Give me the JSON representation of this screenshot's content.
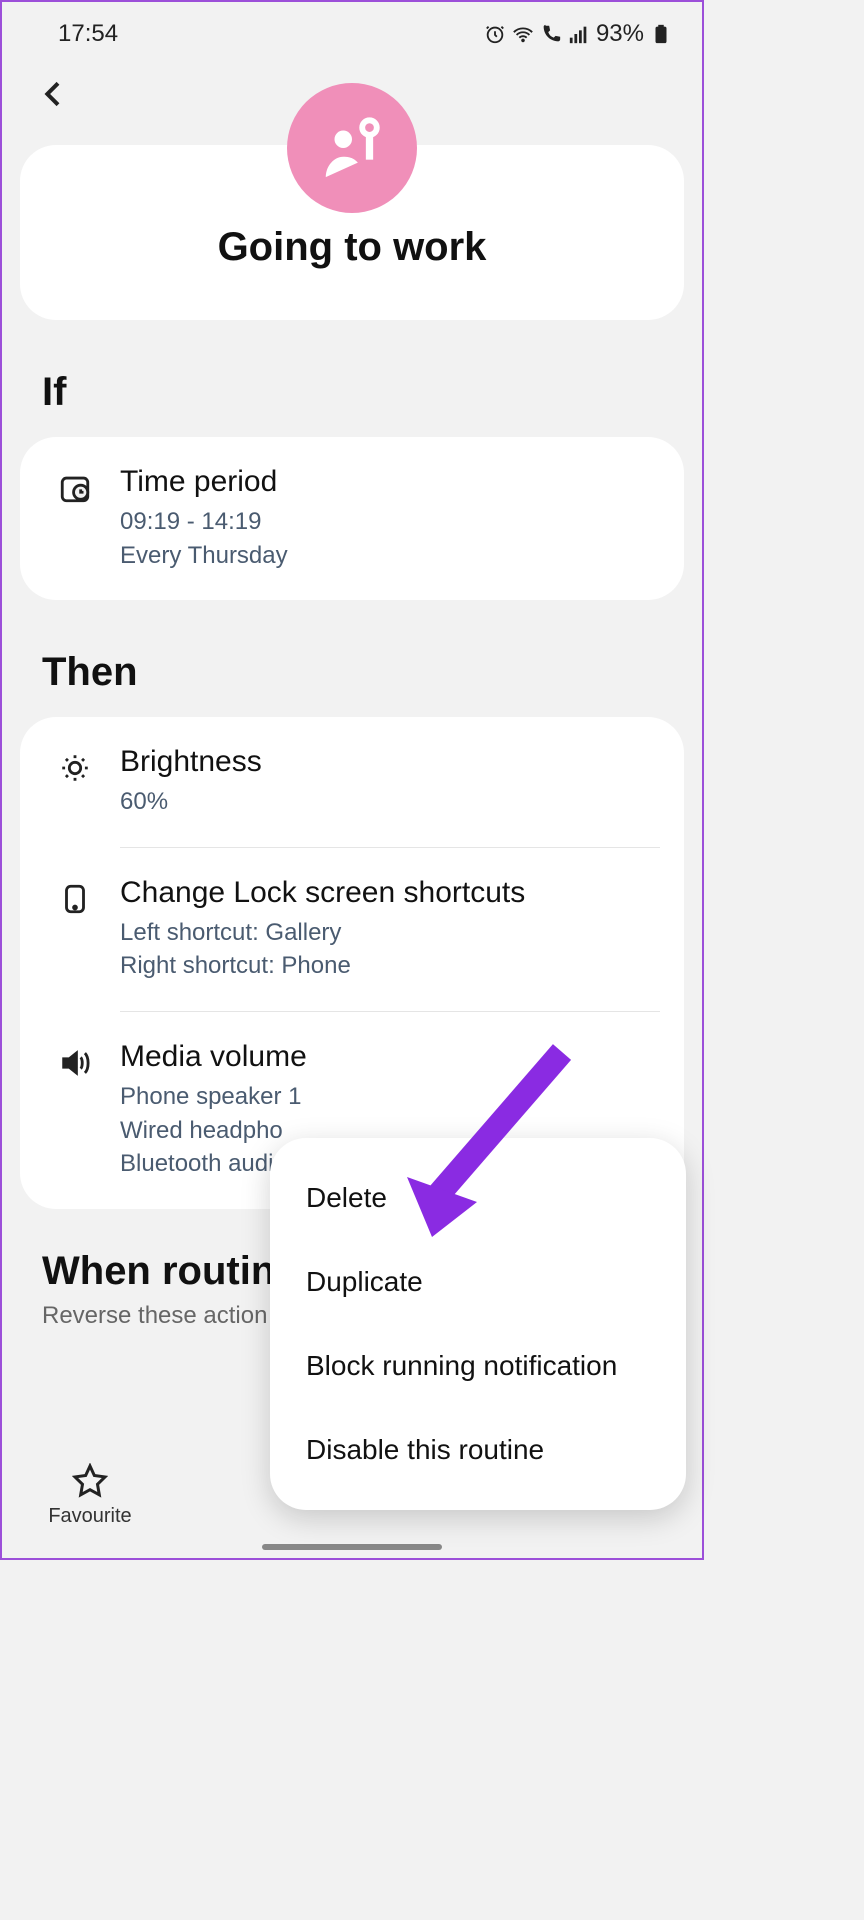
{
  "status": {
    "time": "17:54",
    "battery": "93%"
  },
  "nav": {
    "back": "Back"
  },
  "routine": {
    "title": "Going to work"
  },
  "sections": {
    "if": "If",
    "then": "Then"
  },
  "if_items": [
    {
      "title": "Time period",
      "line1": "09:19 - 14:19",
      "line2": "Every Thursday"
    }
  ],
  "then_items": [
    {
      "title": "Brightness",
      "line1": "60%"
    },
    {
      "title": "Change Lock screen shortcuts",
      "line1": "Left shortcut: Gallery",
      "line2": "Right shortcut: Phone"
    },
    {
      "title": "Media volume",
      "line1": "Phone speaker 1",
      "line2": "Wired headpho",
      "line3": "Bluetooth audi"
    }
  ],
  "when": {
    "title": "When routin",
    "sub": "Reverse these action"
  },
  "bottom": {
    "favourite": "Favourite"
  },
  "popup": {
    "delete": "Delete",
    "duplicate": "Duplicate",
    "block": "Block running notification",
    "disable": "Disable this routine"
  }
}
